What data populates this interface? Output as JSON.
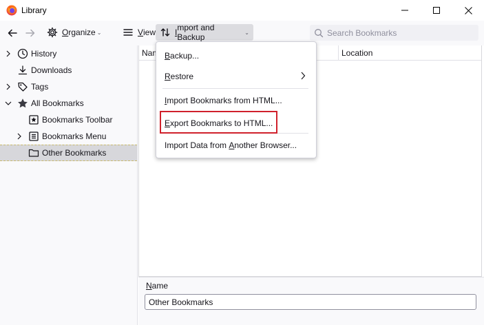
{
  "window": {
    "title": "Library",
    "icon": "firefox-icon",
    "minimize": "minimize-icon",
    "maximize": "maximize-icon",
    "close": "close-icon"
  },
  "toolbar": {
    "back_icon": "arrow-left-icon",
    "forward_icon": "arrow-right-icon",
    "organize_label_u": "O",
    "organize_label_rest": "rganize",
    "views_label_u": "V",
    "views_label_rest": "iews",
    "import_backup_label_u": "I",
    "import_backup_label_rest": "mport and Backup",
    "search_placeholder": "Search Bookmarks"
  },
  "sidebar": {
    "items": [
      {
        "label": "History",
        "icon": "clock-icon",
        "twisty": "collapsed"
      },
      {
        "label": "Downloads",
        "icon": "download-icon",
        "twisty": "none"
      },
      {
        "label": "Tags",
        "icon": "tag-icon",
        "twisty": "collapsed"
      },
      {
        "label": "All Bookmarks",
        "icon": "star-icon",
        "twisty": "expanded"
      },
      {
        "label": "Bookmarks Toolbar",
        "icon": "bookmarks-toolbar-icon",
        "twisty": "none"
      },
      {
        "label": "Bookmarks Menu",
        "icon": "bookmarks-menu-icon",
        "twisty": "collapsed"
      },
      {
        "label": "Other Bookmarks",
        "icon": "folder-icon",
        "twisty": "none",
        "selected": true
      }
    ]
  },
  "columns": {
    "name": "Nam",
    "location": "Location"
  },
  "details": {
    "label_u": "N",
    "label_rest": "ame",
    "value": "Other Bookmarks"
  },
  "menu": {
    "backup_u": "B",
    "backup_rest": "ackup...",
    "restore_u": "R",
    "restore_rest": "estore",
    "import_html_u": "I",
    "import_html_rest": "mport Bookmarks from HTML...",
    "export_html_u": "E",
    "export_html_rest": "xport Bookmarks to HTML...",
    "import_data_pre": "Import Data from ",
    "import_data_u": "A",
    "import_data_rest": "nother Browser..."
  },
  "colors": {
    "highlight": "#d0202b",
    "selected_row": "#d7d7db"
  }
}
